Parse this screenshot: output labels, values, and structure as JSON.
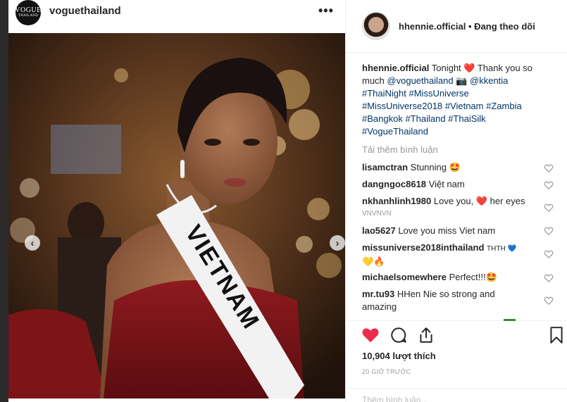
{
  "post_header": {
    "avatar_line1": "VOGUE",
    "avatar_line2": "THAILAND",
    "username": "voguethailand",
    "more_label": "•••"
  },
  "photo": {
    "sash_text": "VIETNAM",
    "prev_arrow": "‹",
    "next_arrow": "›"
  },
  "side_header": {
    "username": "hhennie.official",
    "separator": "•",
    "follow_status": "Đang theo dõi"
  },
  "caption": {
    "username": "hhennie.official",
    "text_1": "Tonight",
    "heart": "❤️",
    "text_2": "Thank you so much",
    "mention_1": "@voguethailand",
    "camera": "📷",
    "mention_2": "@kkentia",
    "hashtags": [
      "#ThaiNight",
      "#MissUniverse",
      "#MissUniverse2018",
      "#Vietnam",
      "#Zambia",
      "#Bangkok",
      "#Thailand",
      "#ThaiSilk",
      "#VogueThailand"
    ]
  },
  "load_more": "Tải thêm bình luận",
  "comments": [
    {
      "user": "lisamctran",
      "text": "Stunning 🤩",
      "sub": ""
    },
    {
      "user": "dangngoc8618",
      "text": "Việt nam",
      "sub": ""
    },
    {
      "user": "nkhanhlinh1980",
      "text": "Love you, ❤️  her eyes",
      "sub": "VNVNVN"
    },
    {
      "user": "lao5627",
      "text": "Love you miss Viet nam",
      "sub": ""
    },
    {
      "user": "missuniverse2018inthailand",
      "text": "THTH 💙",
      "sub": "💛🔥"
    },
    {
      "user": "michaelsomewhere",
      "text": "Perfect!!!🤩",
      "sub": ""
    },
    {
      "user": "mr.tu93",
      "text": "HHen Nie so strong and amazing",
      "sub": ""
    }
  ],
  "icons": {
    "like": "heart-filled-icon",
    "comment": "comment-bubble-icon",
    "share": "share-icon",
    "save": "bookmark-icon",
    "comment_like": "heart-outline-icon"
  },
  "likes": "10,904 lượt thích",
  "time": "20 GIỜ TRƯỚC",
  "add_comment_placeholder": "Thêm bình luận...",
  "colors": {
    "like_red": "#ed2c49",
    "hashtag": "#003569",
    "muted": "#999999"
  }
}
